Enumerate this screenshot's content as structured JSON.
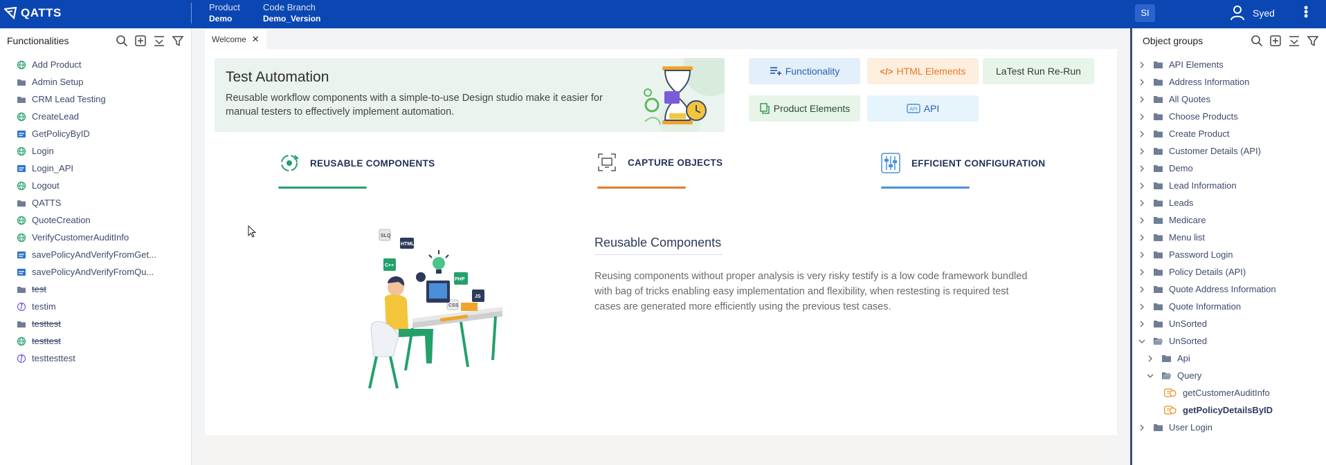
{
  "app": {
    "logo": "QATTS"
  },
  "topbar": {
    "product_label": "Product",
    "product_value": "Demo",
    "branch_label": "Code Branch",
    "branch_value": "Demo_Version",
    "initials": "SI",
    "username": "Syed"
  },
  "left": {
    "title": "Functionalities",
    "items": [
      {
        "label": "Add Product",
        "icon": "globe-icon",
        "strike": false
      },
      {
        "label": "Admin Setup",
        "icon": "folder-icon",
        "strike": false
      },
      {
        "label": "CRM Lead Testing",
        "icon": "folder-icon",
        "strike": false
      },
      {
        "label": "CreateLead",
        "icon": "globe-icon",
        "strike": false
      },
      {
        "label": "GetPolicyByID",
        "icon": "api-icon",
        "strike": false
      },
      {
        "label": "Login",
        "icon": "globe-icon",
        "strike": false
      },
      {
        "label": "Login_API",
        "icon": "api-icon",
        "strike": false
      },
      {
        "label": "Logout",
        "icon": "globe-icon",
        "strike": false
      },
      {
        "label": "QATTS",
        "icon": "folder-icon",
        "strike": false
      },
      {
        "label": "QuoteCreation",
        "icon": "globe-icon",
        "strike": false
      },
      {
        "label": "VerifyCustomerAuditInfo",
        "icon": "globe-icon",
        "strike": false
      },
      {
        "label": "savePolicyAndVerifyFromGet...",
        "icon": "api-icon",
        "strike": false
      },
      {
        "label": "savePolicyAndVerifyFromQu...",
        "icon": "api-icon",
        "strike": false
      },
      {
        "label": "test",
        "icon": "folder-icon",
        "strike": true
      },
      {
        "label": "testim",
        "icon": "testim-icon",
        "strike": false
      },
      {
        "label": "testtest",
        "icon": "folder-icon",
        "strike": true
      },
      {
        "label": "testtest",
        "icon": "globe-icon",
        "strike": true
      },
      {
        "label": "testtesttest",
        "icon": "testim-icon",
        "strike": false
      }
    ]
  },
  "tab": {
    "label": "Welcome"
  },
  "banner": {
    "title": "Test Automation",
    "desc": "Reusable workflow components with a simple-to-use Design studio make it easier for manual testers to effectively implement automation."
  },
  "quick": {
    "functionality": "Functionality",
    "html": "HTML Elements",
    "latest": "LaTest Run Re-Run",
    "product": "Product Elements",
    "api": "API"
  },
  "features": {
    "reusable": "REUSABLE COMPONENTS",
    "capture": "CAPTURE OBJECTS",
    "config": "EFFICIENT CONFIGURATION"
  },
  "detail": {
    "title": "Reusable Components",
    "text": "Reusing components without proper analysis is very risky testify is a low code framework bundled with bag of tricks enabling easy implementation and flexibility, when restesting is required test cases are generated more efficiently using the previous test cases."
  },
  "illustration": {
    "tags": [
      "SLQ",
      "HTML",
      "C++",
      "PHP",
      "CSS",
      "JS"
    ]
  },
  "right": {
    "title": "Object groups",
    "items": [
      {
        "label": "API Elements",
        "level": 0,
        "open": false
      },
      {
        "label": "Address Information",
        "level": 0,
        "open": false
      },
      {
        "label": "All Quotes",
        "level": 0,
        "open": false
      },
      {
        "label": "Choose Products",
        "level": 0,
        "open": false
      },
      {
        "label": "Create Product",
        "level": 0,
        "open": false
      },
      {
        "label": "Customer Details (API)",
        "level": 0,
        "open": false
      },
      {
        "label": "Demo",
        "level": 0,
        "open": false
      },
      {
        "label": "Lead Information",
        "level": 0,
        "open": false
      },
      {
        "label": "Leads",
        "level": 0,
        "open": false
      },
      {
        "label": "Medicare",
        "level": 0,
        "open": false
      },
      {
        "label": "Menu list",
        "level": 0,
        "open": false
      },
      {
        "label": "Password Login",
        "level": 0,
        "open": false
      },
      {
        "label": "Policy Details (API)",
        "level": 0,
        "open": false
      },
      {
        "label": "Quote Address Information",
        "level": 0,
        "open": false
      },
      {
        "label": "Quote Information",
        "level": 0,
        "open": false
      },
      {
        "label": "UnSorted",
        "level": 0,
        "open": false
      },
      {
        "label": "UnSorted",
        "level": 0,
        "open": true
      },
      {
        "label": "Api",
        "level": 1,
        "open": false
      },
      {
        "label": "Query",
        "level": 1,
        "open": true
      },
      {
        "label": "getCustomerAuditInfo",
        "level": 2,
        "leaf": true,
        "bold": false
      },
      {
        "label": "getPolicyDetailsByID",
        "level": 2,
        "leaf": true,
        "bold": true
      },
      {
        "label": "User Login",
        "level": 0,
        "open": false
      }
    ]
  },
  "colors": {
    "brand": "#0b47b3",
    "green": "#24a06b",
    "orange": "#e57a2a",
    "blue": "#4a90d9"
  }
}
